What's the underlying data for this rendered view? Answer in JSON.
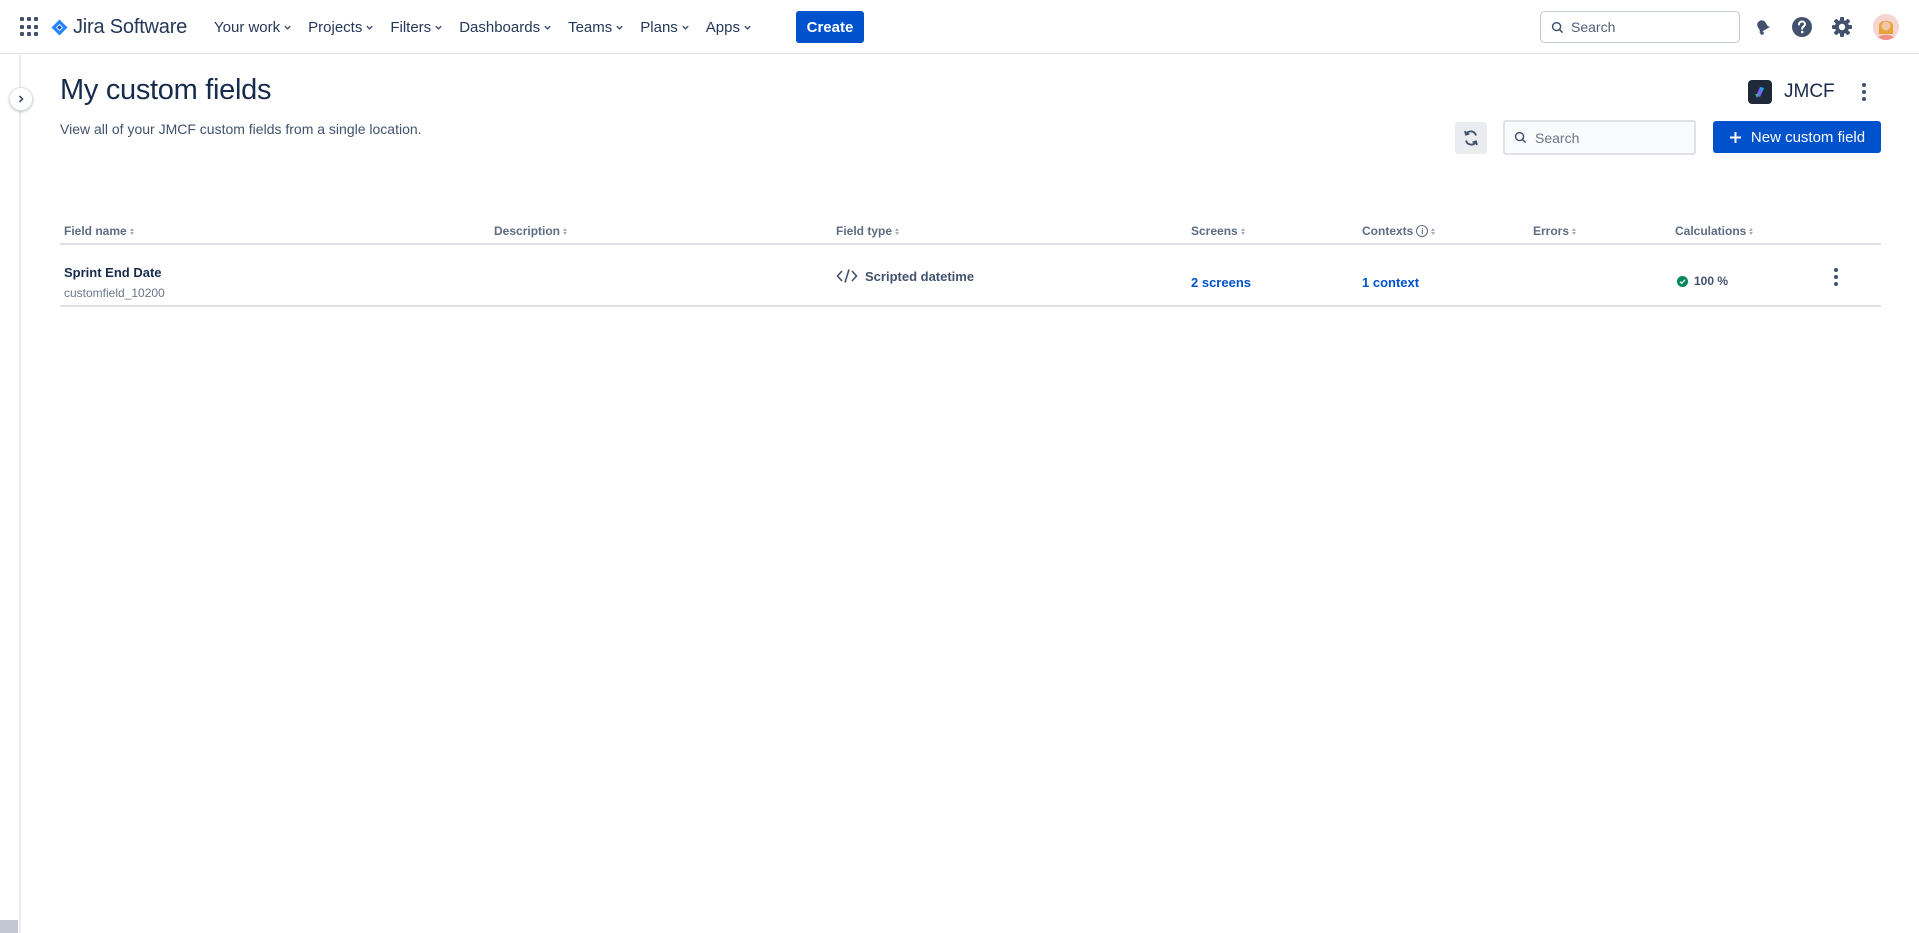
{
  "topnav": {
    "product_name": "Jira Software",
    "nav_items": [
      {
        "label": "Your work"
      },
      {
        "label": "Projects"
      },
      {
        "label": "Filters"
      },
      {
        "label": "Dashboards"
      },
      {
        "label": "Teams"
      },
      {
        "label": "Plans"
      },
      {
        "label": "Apps"
      }
    ],
    "create_label": "Create",
    "search_placeholder": "Search",
    "icons": [
      "app-switcher-icon",
      "notifications-icon",
      "help-icon",
      "settings-icon",
      "avatar"
    ]
  },
  "page": {
    "title": "My custom fields",
    "subtitle": "View all of your JMCF custom fields from a single location.",
    "brand": "JMCF",
    "search_placeholder": "Search",
    "new_field_label": "New custom field"
  },
  "table": {
    "columns": [
      "Field name",
      "Description",
      "Field type",
      "Screens",
      "Contexts",
      "Errors",
      "Calculations"
    ],
    "rows": [
      {
        "name": "Sprint End Date",
        "key": "customfield_10200",
        "description": "",
        "field_type": "Scripted datetime",
        "field_type_icon": "code-icon",
        "screens": "2 screens",
        "contexts": "1 context",
        "errors": "",
        "calculations": "100 %"
      }
    ]
  },
  "colors": {
    "primary": "#0052cc",
    "text": "#172b4d",
    "success": "#00875a",
    "border": "#dfe1e6"
  }
}
